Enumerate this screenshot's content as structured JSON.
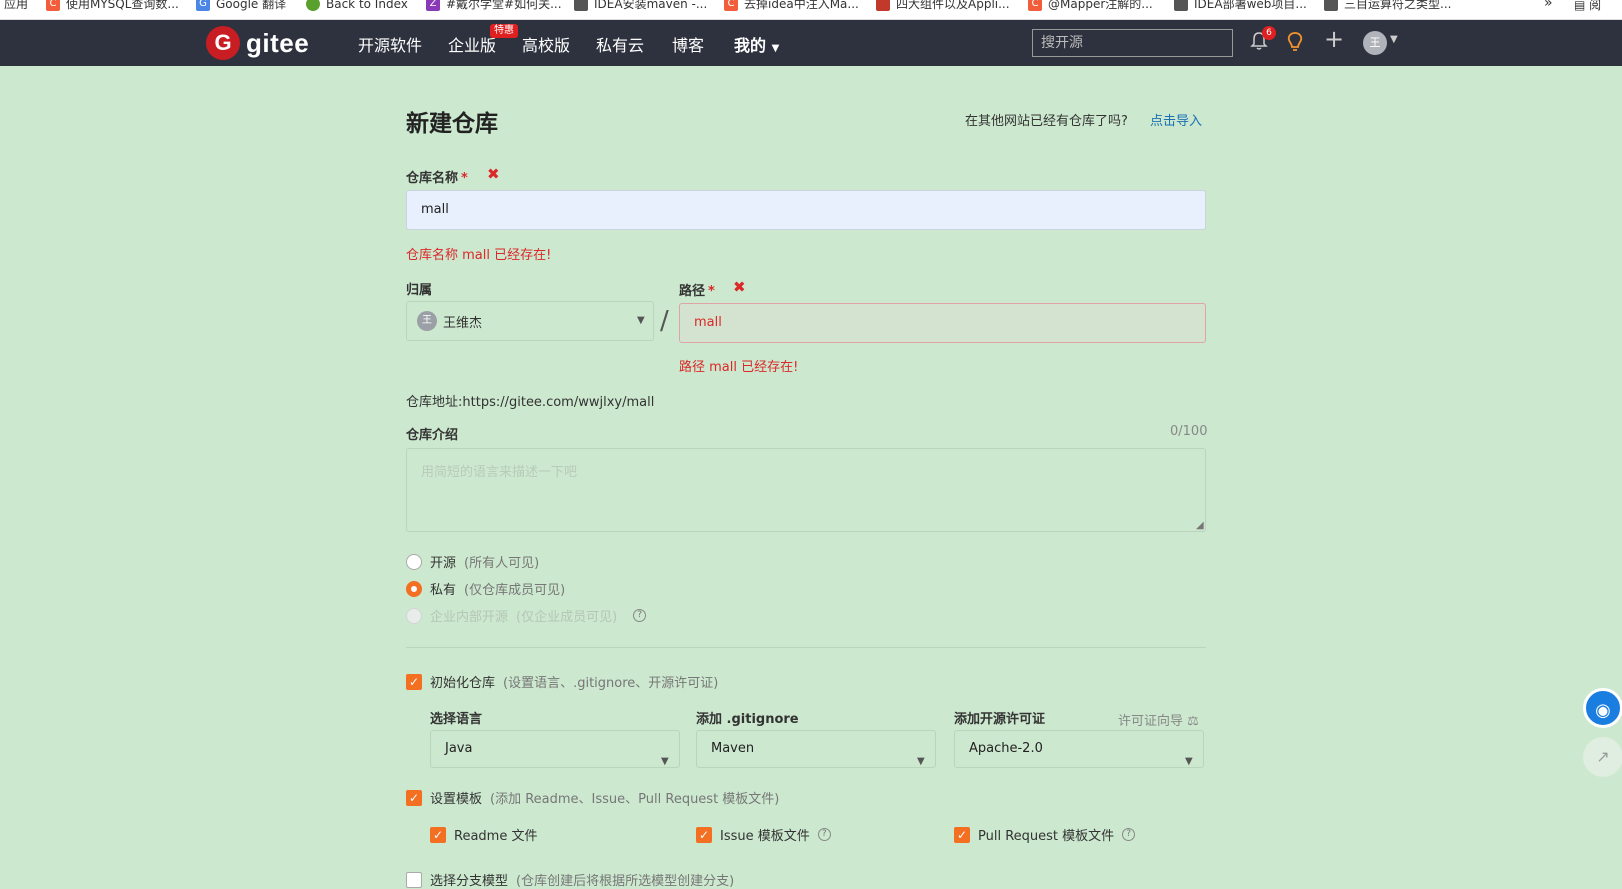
{
  "bookmarks": [
    {
      "label": "应用",
      "icon": "apps-icon",
      "color": "#999999"
    },
    {
      "label": "使用MYSQL查询数...",
      "icon": "csdn-icon",
      "color": "#f25d3b"
    },
    {
      "label": "Google 翻译",
      "icon": "google-translate-icon",
      "color": "#4a86e8"
    },
    {
      "label": "Back to Index",
      "icon": "leaf-icon",
      "color": "#5aa02c"
    },
    {
      "label": "#戴尔学堂#如何关...",
      "icon": "zhihu-icon",
      "color": "#8a3ab9"
    },
    {
      "label": "IDEA安装maven -...",
      "icon": "cnblogs-icon",
      "color": "#555555"
    },
    {
      "label": "去掉idea中注入Ma...",
      "icon": "csdn-icon",
      "color": "#f25d3b"
    },
    {
      "label": "四大组件以及Appli...",
      "icon": "jianshu-icon",
      "color": "#c0392b"
    },
    {
      "label": "@Mapper注解的...",
      "icon": "csdn-icon",
      "color": "#f25d3b"
    },
    {
      "label": "IDEA部署web项目...",
      "icon": "cnblogs-icon",
      "color": "#555555"
    },
    {
      "label": "三目运算符之类型...",
      "icon": "cnblogs-icon",
      "color": "#555555"
    }
  ],
  "bookmarks_more": "»",
  "bookmarks_reading": "阅",
  "nav": {
    "logo_letter": "G",
    "logo_text": "gitee",
    "items": [
      "开源软件",
      "企业版",
      "高校版",
      "私有云",
      "博客",
      "我的"
    ],
    "hot_badge": "特惠",
    "search_placeholder": "搜开源",
    "notification_count": "6",
    "avatar_letter": "王"
  },
  "form": {
    "title": "新建仓库",
    "import_prompt": "在其他网站已经有仓库了吗?",
    "import_link": "点击导入",
    "name_label": "仓库名称",
    "required_mark": "*",
    "name_value": "mall",
    "name_error": "仓库名称 mall 已经存在!",
    "owner_label": "归属",
    "owner_avatar": "王",
    "owner_value": "王维杰",
    "path_label": "路径",
    "path_value": "mall",
    "path_error": "路径 mall 已经存在!",
    "repo_url": "仓库地址:https://gitee.com/wwjlxy/mall",
    "intro_label": "仓库介绍",
    "intro_counter": "0/100",
    "intro_placeholder": "用简短的语言来描述一下吧",
    "visibility": [
      {
        "label": "开源",
        "hint": "(所有人可见)",
        "state": "off"
      },
      {
        "label": "私有",
        "hint": "(仅仓库成员可见)",
        "state": "on"
      },
      {
        "label": "企业内部开源",
        "hint": "(仅企业成员可见)",
        "state": "disabled"
      }
    ],
    "init_repo": {
      "label": "初始化仓库",
      "hint": "(设置语言、.gitignore、开源许可证)",
      "checked": true
    },
    "language_label": "选择语言",
    "language_value": "Java",
    "gitignore_label": "添加 .gitignore",
    "gitignore_value": "Maven",
    "license_label": "添加开源许可证",
    "license_guide": "许可证向导",
    "license_value": "Apache-2.0",
    "template": {
      "label": "设置模板",
      "hint": "(添加 Readme、Issue、Pull Request 模板文件)",
      "checked": true
    },
    "template_files": [
      {
        "label": "Readme 文件",
        "checked": true,
        "help": false
      },
      {
        "label": "Issue 模板文件",
        "checked": true,
        "help": true
      },
      {
        "label": "Pull Request 模板文件",
        "checked": true,
        "help": true
      }
    ],
    "branch_model": {
      "label": "选择分支模型",
      "hint": "(仓库创建后将根据所选模型创建分支)",
      "checked": false
    }
  },
  "colors": {
    "page_bg": "#cce8cf",
    "nav_bg": "#2d323e",
    "accent": "#f36f21",
    "error": "#db2828",
    "link": "#1a6fb5",
    "brand": "#c71d23"
  }
}
